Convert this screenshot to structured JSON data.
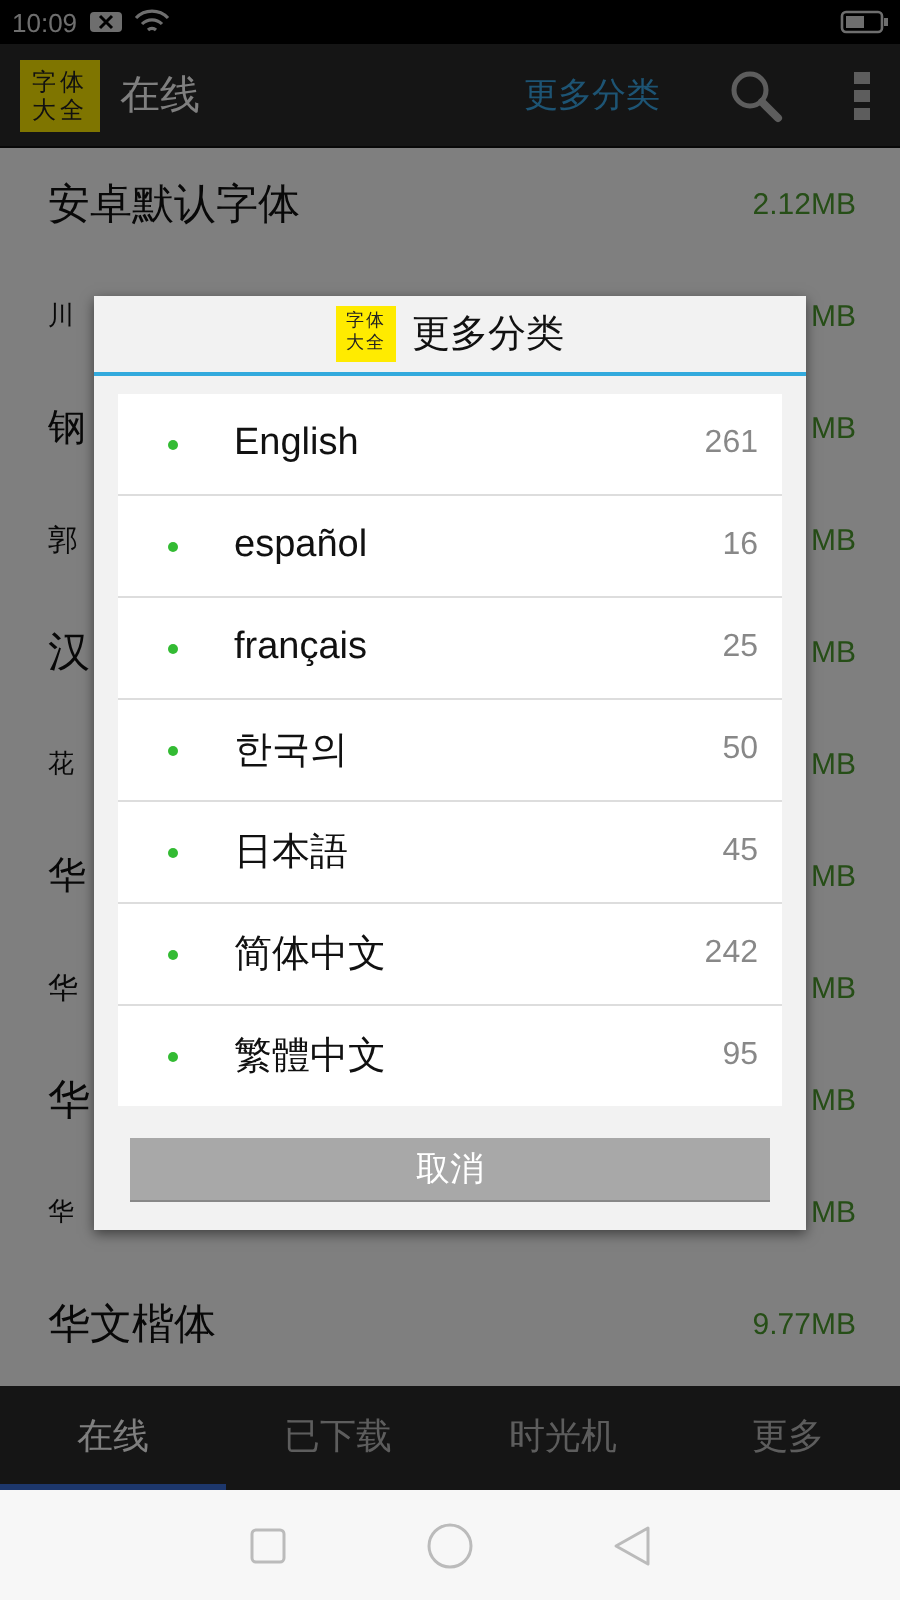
{
  "status_bar": {
    "time": "10:09"
  },
  "app_bar": {
    "logo": "字体大全",
    "title": "在线",
    "action": "更多分类"
  },
  "fonts": [
    {
      "name": "安卓默认字体",
      "size": "2.12MB"
    },
    {
      "name": "川",
      "size": "MB"
    },
    {
      "name": "钢",
      "size": "MB"
    },
    {
      "name": "郭",
      "size": "MB"
    },
    {
      "name": "汉",
      "size": "MB"
    },
    {
      "name": "花",
      "size": "MB"
    },
    {
      "name": "华",
      "size": "MB"
    },
    {
      "name": "华",
      "size": "MB"
    },
    {
      "name": "华",
      "size": "MB"
    },
    {
      "name": "华",
      "size": "MB"
    },
    {
      "name": "华文楷体",
      "size": "9.77MB"
    }
  ],
  "dialog": {
    "logo": "字体大全",
    "title": "更多分类",
    "items": [
      {
        "label": "English",
        "count": "261"
      },
      {
        "label": "español",
        "count": "16"
      },
      {
        "label": "français",
        "count": "25"
      },
      {
        "label": "한국의",
        "count": "50"
      },
      {
        "label": "日本語",
        "count": "45"
      },
      {
        "label": "简体中文",
        "count": "242"
      },
      {
        "label": "繁體中文",
        "count": "95"
      }
    ],
    "cancel": "取消"
  },
  "tabs": [
    {
      "label": "在线",
      "selected": true
    },
    {
      "label": "已下载",
      "selected": false
    },
    {
      "label": "时光机",
      "selected": false
    },
    {
      "label": "更多",
      "selected": false
    }
  ]
}
